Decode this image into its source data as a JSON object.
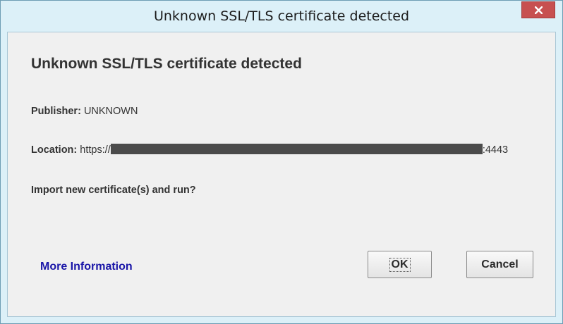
{
  "window": {
    "title": "Unknown SSL/TLS certificate detected",
    "close_symbol": "x"
  },
  "dialog": {
    "heading": "Unknown SSL/TLS certificate detected",
    "publisher_label": "Publisher:",
    "publisher_value": "UNKNOWN",
    "location_label": "Location:",
    "location_prefix": "https://",
    "location_suffix": ":4443",
    "question": "Import new certificate(s) and run?",
    "more_info_link": "More Information",
    "ok_label": "OK",
    "cancel_label": "Cancel"
  },
  "icons": {
    "close": "close-icon"
  },
  "colors": {
    "close_button": "#c75050",
    "link": "#1a16a8",
    "title_background": "#dcf0f8"
  }
}
